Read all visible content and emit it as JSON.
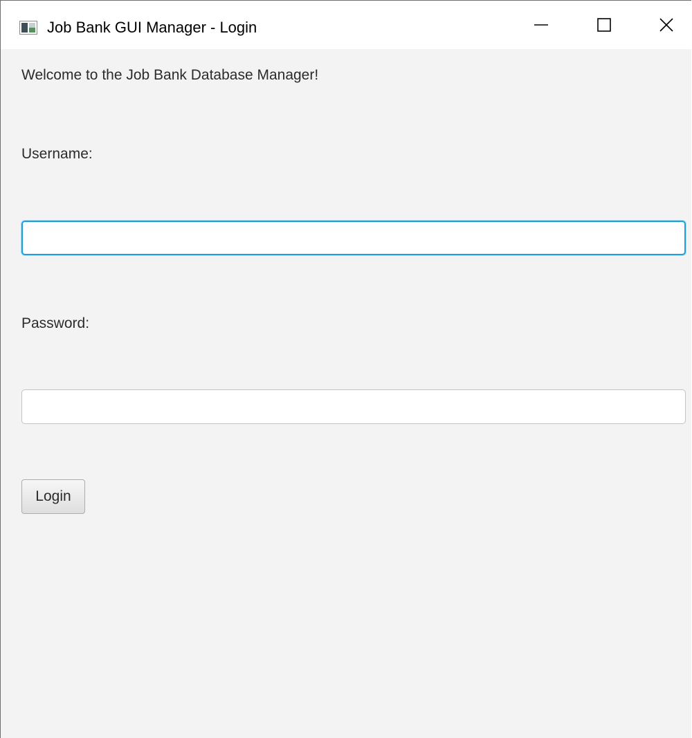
{
  "window": {
    "title": "Job Bank GUI Manager - Login",
    "controls": {
      "minimize_icon": "minimize-icon",
      "maximize_icon": "maximize-icon",
      "close_icon": "close-icon"
    }
  },
  "content": {
    "welcome_text": "Welcome to the Job Bank Database Manager!",
    "username_label": "Username:",
    "username_value": "",
    "password_label": "Password:",
    "password_value": "",
    "login_label": "Login"
  },
  "colors": {
    "background": "#f3f3f3",
    "focus_border": "#1ea0dd",
    "text": "#2b2b2b"
  }
}
